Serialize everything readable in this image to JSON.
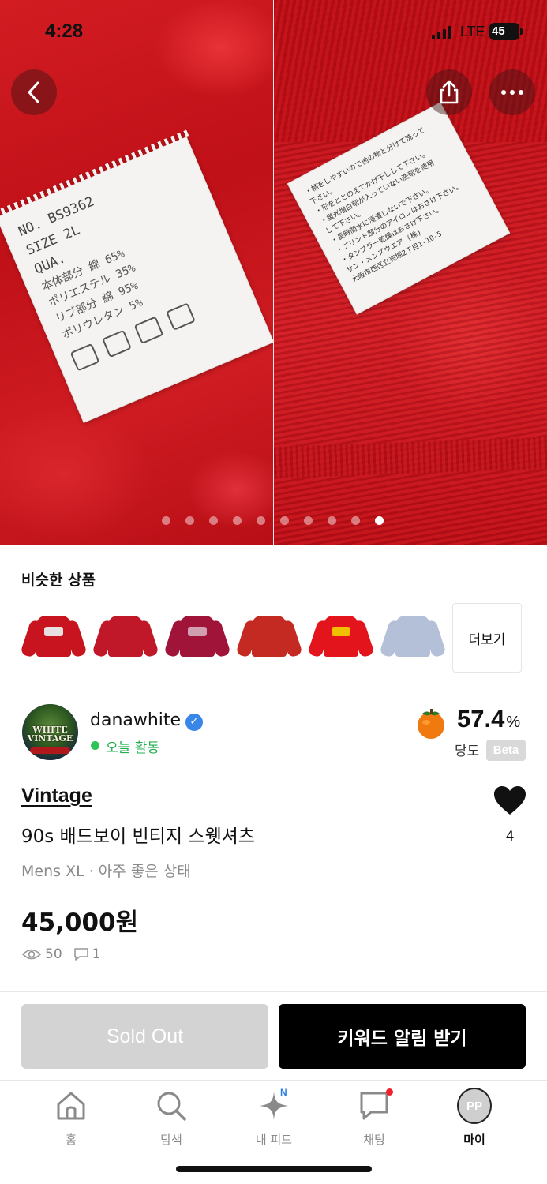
{
  "status_bar": {
    "time": "4:28",
    "network": "LTE",
    "battery": "45"
  },
  "gallery": {
    "page_count": 10,
    "current_page": 10,
    "left_tag_lines": [
      "NO. BS9362",
      "SIZE  2L",
      "QUA.",
      "本体部分   綿        65%",
      "          ポリエステル 35%",
      "リブ部分   綿        95%",
      "          ポリウレタン 5%"
    ],
    "right_tag_lines": [
      "・柄をしやすいので他の物と分けて洗って",
      "  下さい。",
      "・形をととのえてかげ干しして下さい。",
      "・蛍光増白剤が入っていない洗剤を使用",
      "  して下さい。",
      "・長時間水に浸漬しないで下さい。",
      "・プリント部分のアイロンはおさけ下さい。",
      "・タンブラー乾燥はおさけ下さい。",
      "  サン・メンズウエア (株)",
      "  大阪市西区立売堀2丁目1-10-5"
    ]
  },
  "similar": {
    "title": "비슷한 상품",
    "more_label": "더보기",
    "items": [
      {
        "name": "similar-item-1",
        "color": "#c8141e",
        "print": "#e8e0e0"
      },
      {
        "name": "similar-item-2",
        "color": "#c01828",
        "print": "#c01828"
      },
      {
        "name": "similar-item-3",
        "color": "#a0143a",
        "print": "#d0a0b0"
      },
      {
        "name": "similar-item-4",
        "color": "#c42a22",
        "print": "#c42a22"
      },
      {
        "name": "similar-item-5",
        "color": "#e4141c",
        "print": "#f0c000"
      },
      {
        "name": "similar-item-6",
        "color": "#b4c0d8",
        "print": "#b4c0d8"
      }
    ]
  },
  "seller": {
    "name": "danawhite",
    "avatar_text": "WHITE VINTAGE",
    "activity": "오늘 활동",
    "sweetness_value": "57.4",
    "sweetness_unit": "%",
    "sweetness_label": "당도",
    "beta": "Beta"
  },
  "product": {
    "brand": "Vintage",
    "title": "90s 배드보이 빈티지 스웻셔츠",
    "meta": "Mens XL · 아주 좋은 상태",
    "price": "45,000원",
    "likes": "4",
    "views": "50",
    "comments": "1"
  },
  "actions": {
    "sold_out": "Sold Out",
    "keyword_alert": "키워드 알림 받기"
  },
  "tabbar": {
    "home": "홈",
    "explore": "탐색",
    "feed": "내 피드",
    "feed_badge": "N",
    "chat": "채팅",
    "my": "마이",
    "my_avatar": "PP"
  },
  "colors": {
    "accent_green": "#21b04f",
    "verified_blue": "#3a86e8",
    "sold_out_gray": "#d3d3d3",
    "primary_black": "#000000"
  }
}
